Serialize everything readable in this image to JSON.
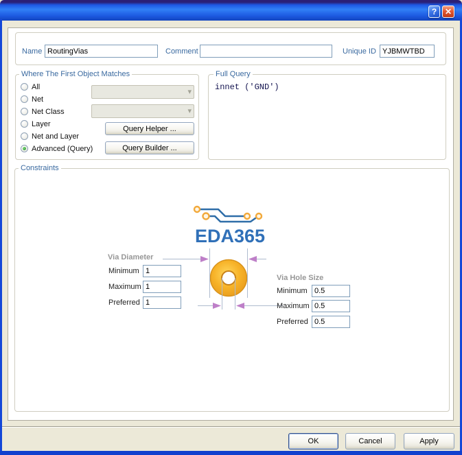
{
  "window": {
    "title": "",
    "icons": {
      "help": "?",
      "close": "✕",
      "chevron_down": "▾"
    }
  },
  "header": {
    "name_label": "Name",
    "name_value": "RoutingVias",
    "comment_label": "Comment",
    "comment_value": "",
    "unique_id_label": "Unique ID",
    "unique_id_value": "YJBMWTBD"
  },
  "where": {
    "title": "Where The First Object Matches",
    "options": [
      {
        "label": "All",
        "selected": false
      },
      {
        "label": "Net",
        "selected": false
      },
      {
        "label": "Net Class",
        "selected": false
      },
      {
        "label": "Layer",
        "selected": false
      },
      {
        "label": "Net and Layer",
        "selected": false
      },
      {
        "label": "Advanced (Query)",
        "selected": true
      }
    ],
    "query_helper_label": "Query Helper ...",
    "query_builder_label": "Query Builder ..."
  },
  "full_query": {
    "title": "Full Query",
    "text": "innet ('GND')"
  },
  "constraints": {
    "title": "Constraints",
    "logo_text": "EDA365",
    "via_diameter": {
      "title": "Via Diameter",
      "rows": [
        {
          "label": "Minimum",
          "value": "1"
        },
        {
          "label": "Maximum",
          "value": "1"
        },
        {
          "label": "Preferred",
          "value": "1"
        }
      ]
    },
    "via_hole_size": {
      "title": "Via Hole Size",
      "rows": [
        {
          "label": "Minimum",
          "value": "0.5"
        },
        {
          "label": "Maximum",
          "value": "0.5"
        },
        {
          "label": "Preferred",
          "value": "0.5"
        }
      ]
    }
  },
  "footer": {
    "ok_label": "OK",
    "cancel_label": "Cancel",
    "apply_label": "Apply"
  },
  "colors": {
    "titlebar_blue": "#1E58E4",
    "window_border_blue": "#1447D8",
    "client_bg": "#ECE9D8",
    "group_title_blue": "#39699F",
    "via_orange": "#F7B329",
    "via_orange_edge": "#D8921A",
    "dimension_arrow_purple": "#BE7FC8",
    "dimension_line_gray": "#AEBBCE",
    "logo_trace_blue": "#2E6DA8",
    "logo_pad_orange": "#F2A93B",
    "logo_text_blue": "#3070B8",
    "query_text_navy": "#12124E",
    "help_button_blue": "#3E77E8",
    "close_button_red": "#E45932",
    "radio_selected_green": "#2E8F2E"
  }
}
